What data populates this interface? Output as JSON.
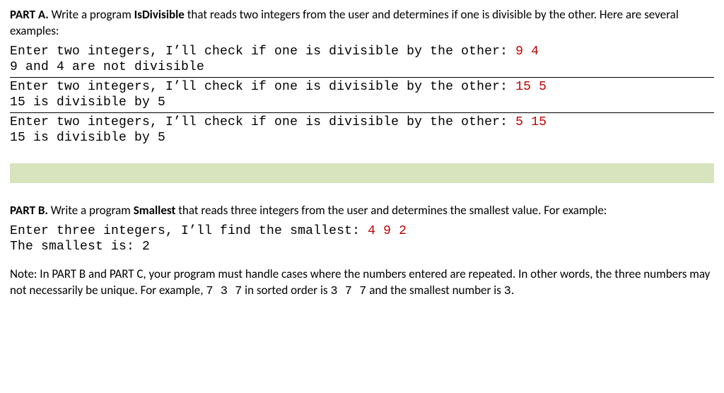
{
  "partA": {
    "label": "PART A.",
    "intro1": " Write a program ",
    "program": "IsDivisible",
    "intro2": " that reads two integers from the user and determines if one is divisible by the other. Here are several examples:",
    "ex1": {
      "prompt": "Enter two integers, I’ll check if one is divisible by the other: ",
      "input": "9 4",
      "result": "9 and 4 are not divisible"
    },
    "ex2": {
      "prompt": "Enter two integers, I’ll check if one is divisible by the other: ",
      "input": "15 5",
      "result": "15 is divisible by 5"
    },
    "ex3": {
      "prompt": "Enter two integers, I’ll check if one is divisible by the other: ",
      "input": "5 15",
      "result": "15 is divisible by 5"
    }
  },
  "partB": {
    "label": "PART B.",
    "intro1": " Write a program ",
    "program": "Smallest",
    "intro2": " that reads three integers from the user and determines the smallest value. For example:",
    "ex1": {
      "prompt": "Enter three integers, I’ll find the smallest: ",
      "input": "4 9 2",
      "result": "The smallest is: 2"
    },
    "note1": "Note: In PART B and PART C, your program must handle cases where the numbers entered are repeated. In other words, the three numbers may not necessarily be unique. For example, ",
    "code1": "7 3 7",
    "note2": " in sorted order is ",
    "code2": "3 7 7",
    "note3": " and the smallest number is ",
    "code3": "3",
    "note4": "."
  }
}
